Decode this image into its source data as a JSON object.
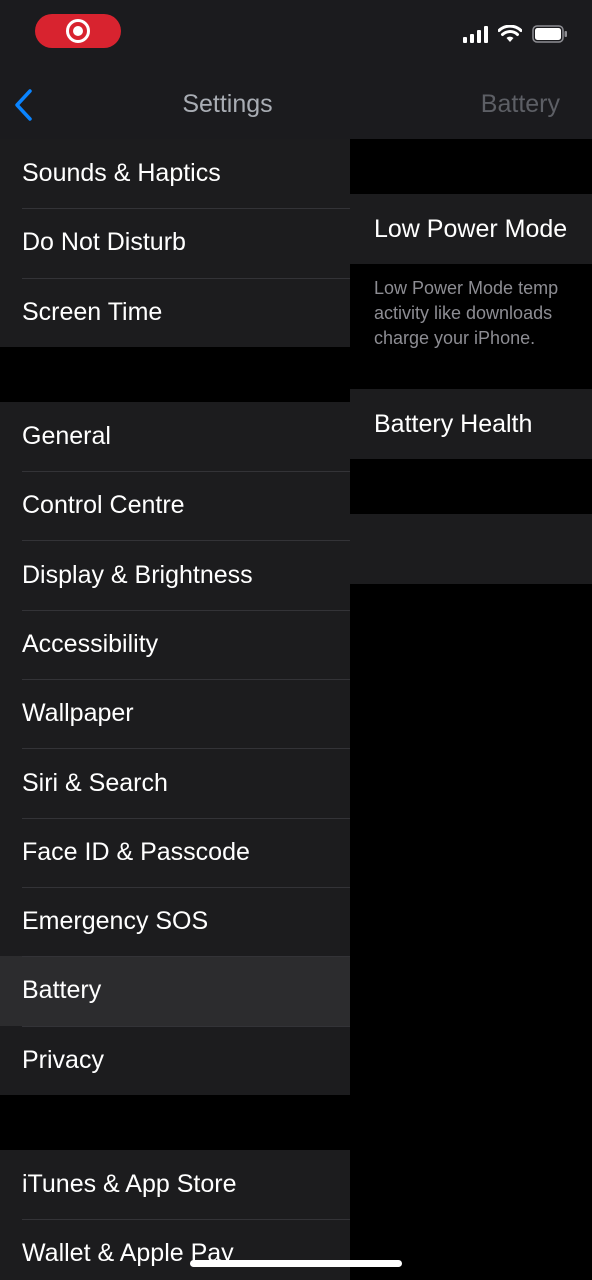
{
  "status_bar": {
    "recording_indicator": "screen-recording",
    "icons": [
      "signal-icon",
      "wifi-icon",
      "battery-icon"
    ]
  },
  "nav": {
    "back_icon": "chevron-left-icon",
    "title": "Settings",
    "detail_title": "Battery"
  },
  "settings_list": {
    "group1": [
      "Sounds & Haptics",
      "Do Not Disturb",
      "Screen Time"
    ],
    "group2": [
      "General",
      "Control Centre",
      "Display & Brightness",
      "Accessibility",
      "Wallpaper",
      "Siri & Search",
      "Face ID & Passcode",
      "Emergency SOS",
      "Battery",
      "Privacy"
    ],
    "group3": [
      "iTunes & App Store",
      "Wallet & Apple Pay"
    ],
    "selected": "Battery"
  },
  "detail": {
    "low_power_mode": "Low Power Mode",
    "low_power_footer": [
      "Low Power Mode temp",
      "activity like downloads",
      "charge your iPhone."
    ],
    "battery_health": "Battery Health"
  },
  "colors": {
    "accent": "#0a84ff",
    "record_red": "#d8232f",
    "cell_bg": "#1c1c1e",
    "selected_bg": "#2c2c2e"
  }
}
